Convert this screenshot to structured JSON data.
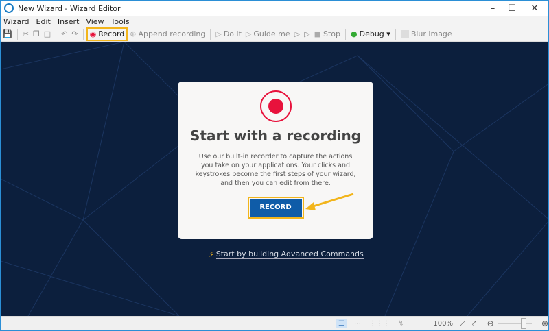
{
  "window": {
    "title": "New Wizard - Wizard Editor"
  },
  "menu": [
    "Wizard",
    "Edit",
    "Insert",
    "View",
    "Tools"
  ],
  "toolbar": {
    "record": "Record",
    "append": "Append recording",
    "do_it": "Do it",
    "guide_me": "Guide me",
    "stop": "Stop",
    "debug": "Debug",
    "blur": "Blur image"
  },
  "card": {
    "title": "Start with a recording",
    "body": "Use our built-in recorder to capture the actions you take on your applications. Your clicks and keystrokes become the first steps of your wizard, and then you can edit from there.",
    "button": "RECORD"
  },
  "advanced_link": "Start by building Advanced Commands",
  "status": {
    "zoom": "100%",
    "zoom_slider": 0.5
  }
}
